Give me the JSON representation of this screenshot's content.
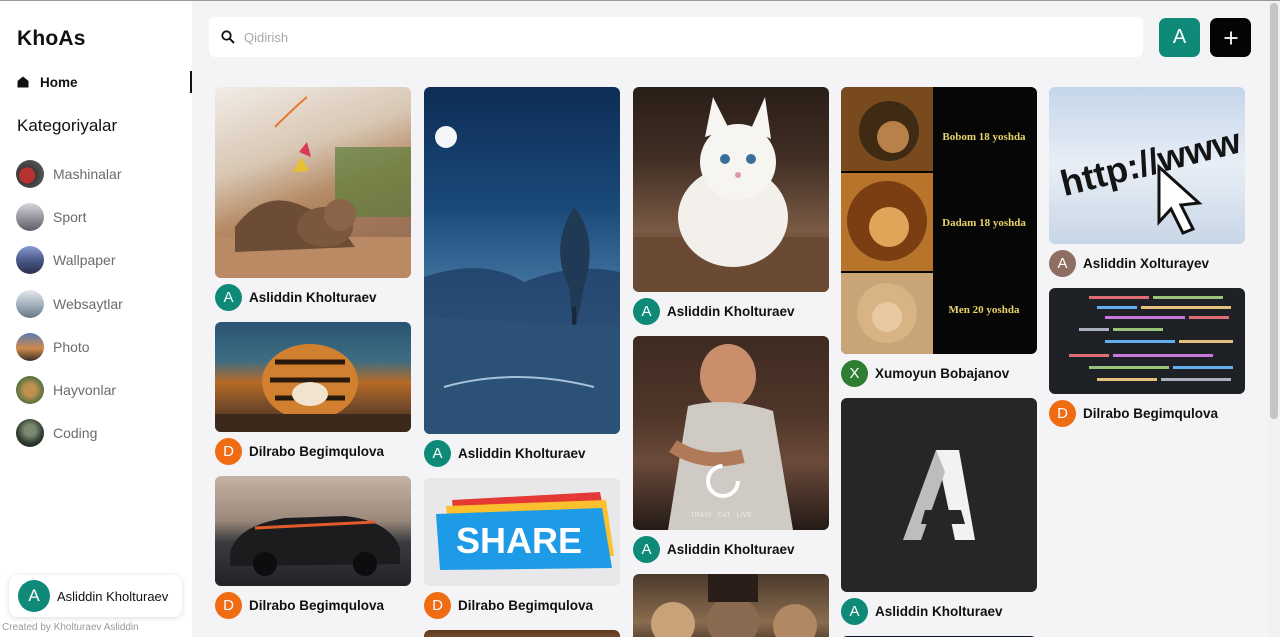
{
  "brand": "KhoAs",
  "nav": {
    "home_label": "Home"
  },
  "categories": {
    "title": "Kategoriyalar",
    "items": [
      {
        "label": "Mashinalar",
        "color": "#8a2f2f"
      },
      {
        "label": "Sport",
        "color": "#8c8c95"
      },
      {
        "label": "Wallpaper",
        "color": "#4b5a8a"
      },
      {
        "label": "Websaytlar",
        "color": "#7a8c9a"
      },
      {
        "label": "Photo",
        "color": "#c27a4a"
      },
      {
        "label": "Hayvonlar",
        "color": "#7a6a44"
      },
      {
        "label": "Coding",
        "color": "#2f3a30"
      }
    ]
  },
  "profile": {
    "initial": "A",
    "name": "Asliddin Kholturaev"
  },
  "credits": "Created by Kholturaev Asliddin",
  "search": {
    "placeholder": "Qidirish"
  },
  "header": {
    "avatar_initial": "A"
  },
  "columns": [
    [
      {
        "image": "kitten-play",
        "initial": "A",
        "author": "Asliddin Kholturaev"
      },
      {
        "image": "tiger",
        "initial": "D",
        "author": "Dilrabo Begimqulova"
      },
      {
        "image": "car",
        "initial": "D",
        "author": "Dilrabo Begimqulova"
      }
    ],
    [
      {
        "image": "night-landscape",
        "initial": "A",
        "author": "Asliddin Kholturaev"
      },
      {
        "image": "share-sign",
        "initial": "D",
        "author": "Dilrabo Begimqulova",
        "text": "SHARE"
      }
    ],
    [
      {
        "image": "white-kitten",
        "initial": "A",
        "author": "Asliddin Kholturaev"
      },
      {
        "image": "boxer-man",
        "initial": "A",
        "author": "Asliddin Kholturaev",
        "text": "TRAIN · EAT · LIVE"
      }
    ],
    [
      {
        "image": "lions",
        "initial": "X",
        "author": "Xumoyun Bobajanov",
        "captions": [
          "Bobom 18 yoshda",
          "Dadam 18 yoshda",
          "Men 20 yoshda"
        ]
      },
      {
        "image": "a-logo",
        "initial": "A",
        "author": "Asliddin Kholturaev"
      }
    ],
    [
      {
        "image": "http-cursor",
        "initial": "A",
        "author": "Asliddin Xolturayev",
        "text": "http://www"
      },
      {
        "image": "code-screen",
        "initial": "D",
        "author": "Dilrabo Begimqulova"
      }
    ]
  ]
}
